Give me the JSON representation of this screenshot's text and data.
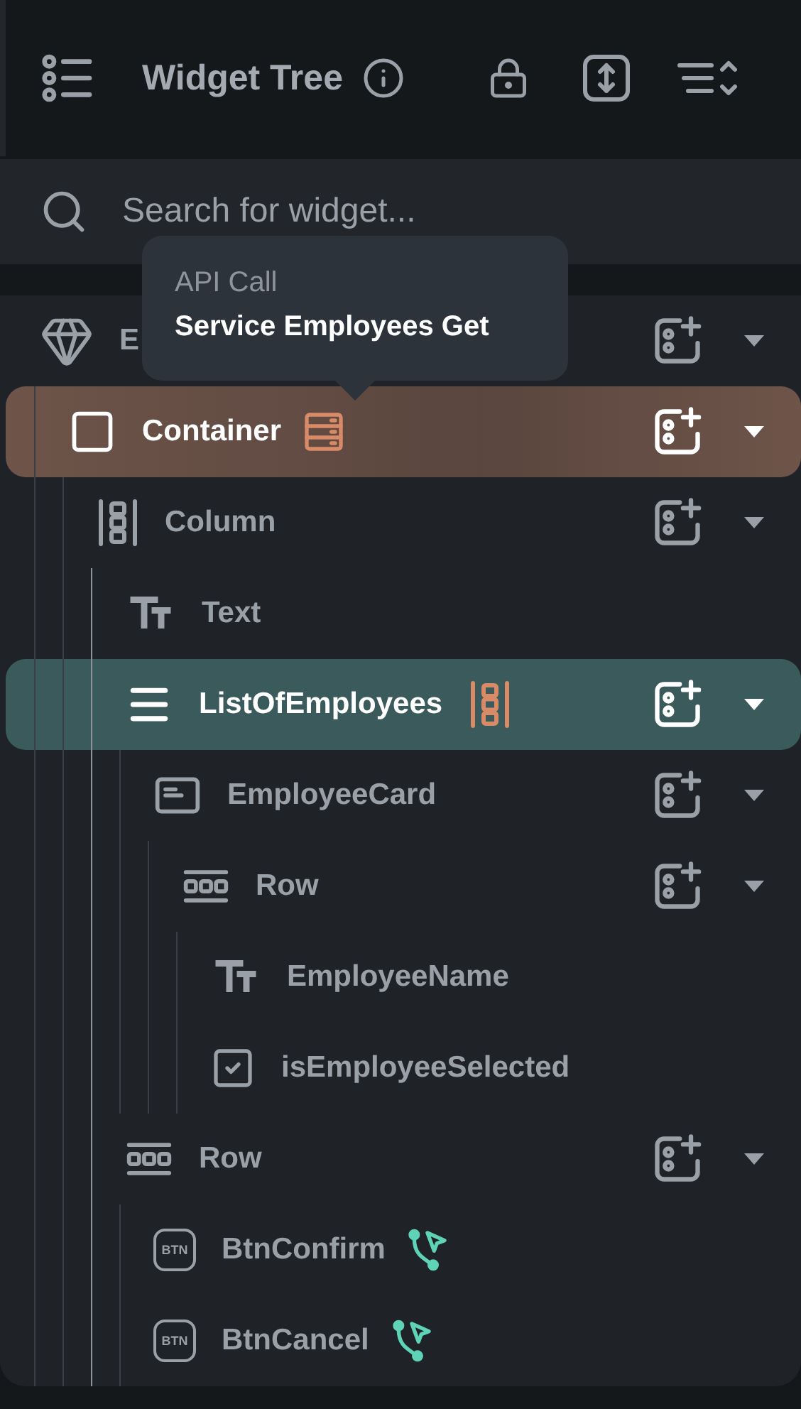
{
  "header": {
    "title": "Widget Tree"
  },
  "search": {
    "placeholder": "Search for widget..."
  },
  "tooltip": {
    "title": "API Call",
    "subtitle": "Service Employees Get"
  },
  "tree": [
    {
      "label": "E",
      "kind": "gem",
      "addable": true,
      "hovered": false,
      "selected": false,
      "children": [
        {
          "label": "Container",
          "kind": "container",
          "badge": {
            "kind": "api"
          },
          "addable": true,
          "hovered": true,
          "selected": false,
          "children": [
            {
              "label": "Column",
              "kind": "column",
              "addable": true,
              "hovered": false,
              "selected": false,
              "children": [
                {
                  "label": "Text",
                  "kind": "text",
                  "addable": false,
                  "hovered": false,
                  "selected": false
                },
                {
                  "label": "ListOfEmployees",
                  "kind": "list",
                  "badge": {
                    "kind": "generator"
                  },
                  "addable": true,
                  "hovered": false,
                  "selected": true,
                  "children": [
                    {
                      "label": "EmployeeCard",
                      "kind": "card",
                      "addable": true,
                      "hovered": false,
                      "selected": false,
                      "children": [
                        {
                          "label": "Row",
                          "kind": "row",
                          "addable": true,
                          "hovered": false,
                          "selected": false,
                          "children": [
                            {
                              "label": "EmployeeName",
                              "kind": "text",
                              "addable": false,
                              "hovered": false,
                              "selected": false
                            },
                            {
                              "label": "isEmployeeSelected",
                              "kind": "checkbox",
                              "addable": false,
                              "hovered": false,
                              "selected": false
                            }
                          ]
                        }
                      ]
                    }
                  ]
                },
                {
                  "label": "Row",
                  "kind": "row",
                  "addable": true,
                  "hovered": false,
                  "selected": false,
                  "children": [
                    {
                      "label": "BtnConfirm",
                      "kind": "button",
                      "icon_text": "BTN",
                      "badge": {
                        "kind": "action"
                      },
                      "addable": false,
                      "hovered": false,
                      "selected": false
                    },
                    {
                      "label": "BtnCancel",
                      "kind": "button",
                      "icon_text": "BTN",
                      "badge": {
                        "kind": "action"
                      },
                      "addable": false,
                      "hovered": false,
                      "selected": false
                    }
                  ]
                }
              ]
            }
          ]
        }
      ]
    }
  ]
}
